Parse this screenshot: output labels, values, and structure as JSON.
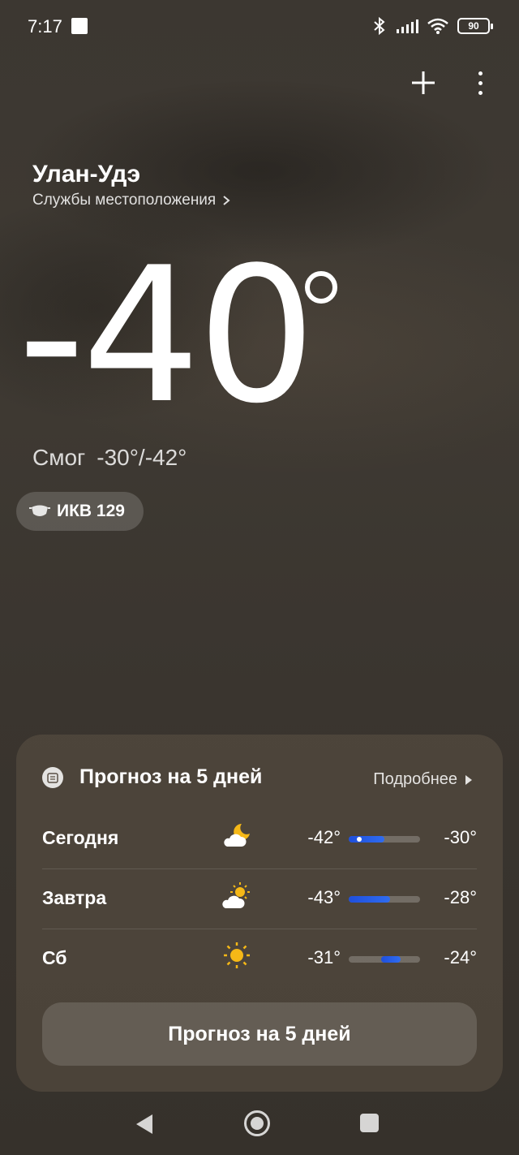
{
  "status_bar": {
    "time": "7:17",
    "battery": "90"
  },
  "location": {
    "city": "Улан-Удэ",
    "services_link": "Службы местоположения"
  },
  "current": {
    "temperature": "-40",
    "condition": "Смог",
    "range": "-30°/-42°",
    "aqi_label": "ИКВ 129"
  },
  "forecast": {
    "title": "Прогноз на 5 дней",
    "more_label": "Подробнее",
    "button_label": "Прогноз на 5 дней",
    "days": [
      {
        "day": "Сегодня",
        "icon": "moon-cloud-icon",
        "min": "-42°",
        "max": "-30°",
        "bar_start": 0.0,
        "bar_end": 0.5,
        "current_marker": 0.15
      },
      {
        "day": "Завтра",
        "icon": "sun-cloud-icon",
        "min": "-43°",
        "max": "-28°",
        "bar_start": 0.0,
        "bar_end": 0.58
      },
      {
        "day": "Сб",
        "icon": "sun-icon",
        "min": "-31°",
        "max": "-24°",
        "bar_start": 0.46,
        "bar_end": 0.73
      }
    ]
  },
  "colors": {
    "bar_fill": "#2f6cf0",
    "sun": "#f5b817"
  }
}
